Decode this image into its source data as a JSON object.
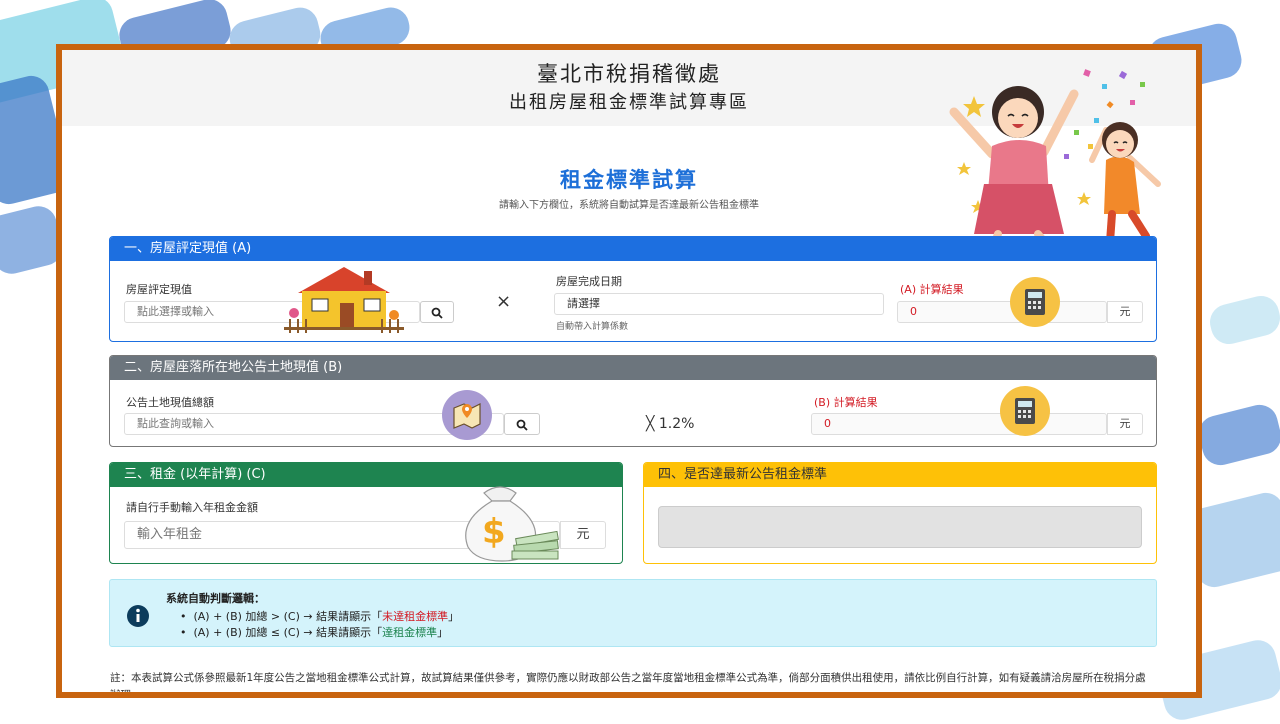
{
  "header": {
    "title": "臺北市稅捐稽徵處",
    "subtitle": "出租房屋租金標準試算專區"
  },
  "main": {
    "title": "租金標準試算",
    "subtitle": "請輸入下方欄位，系統將自動試算是否達最新公告租金標準"
  },
  "section_a": {
    "header": "一、房屋評定現值 (A)",
    "value_label": "房屋評定現值",
    "value_placeholder": "點此選擇或輸入",
    "multiply": "×",
    "date_label": "房屋完成日期",
    "date_select": "請選擇",
    "date_hint": "自動帶入計算係數",
    "result_label": "(A) 計算結果",
    "result_value": "0",
    "unit": "元"
  },
  "section_b": {
    "header": "二、房屋座落所在地公告土地現值 (B)",
    "value_label": "公告土地現值總額",
    "value_placeholder": "點此查詢或輸入",
    "multiply": "╳ 1.2%",
    "result_label": "(B) 計算結果",
    "result_value": "0",
    "unit": "元"
  },
  "section_c": {
    "header": "三、租金 (以年計算) (C)",
    "value_label": "請自行手動輸入年租金金額",
    "value_placeholder": "輸入年租金",
    "unit": "元"
  },
  "section_d": {
    "header": "四、是否達最新公告租金標準",
    "result_value": ""
  },
  "info": {
    "title": "系統自動判斷邏輯：",
    "rule1_prefix": "(A) + (B) 加總 > (C) → 結果請顯示「",
    "rule1_result": "未達租金標準",
    "rule1_suffix": "」",
    "rule2_prefix": "(A) + (B) 加總 ≤ (C) → 結果請顯示「",
    "rule2_result": "達租金標準",
    "rule2_suffix": "」"
  },
  "footer_note": "註：本表試算公式係參照最新1年度公告之當地租金標準公式計算，故試算結果僅供參考，實際仍應以財政部公告之當年度當地租金標準公式為準，倘部分面積供出租使用，請依比例自行計算，如有疑義請洽房屋所在稅捐分處辦理。",
  "colors": {
    "frame": "#c8640f",
    "section_a": "#1d6fe0",
    "section_b": "#6c757d",
    "section_c": "#1e8450",
    "section_d": "#fec107",
    "title_blue": "#1d6fd8",
    "alert_red": "#d31b24"
  },
  "icons": [
    "search-icon",
    "house-illustration",
    "map-icon",
    "calculator-icon",
    "money-bag-illustration",
    "info-icon",
    "celebrating-family-illustration"
  ]
}
